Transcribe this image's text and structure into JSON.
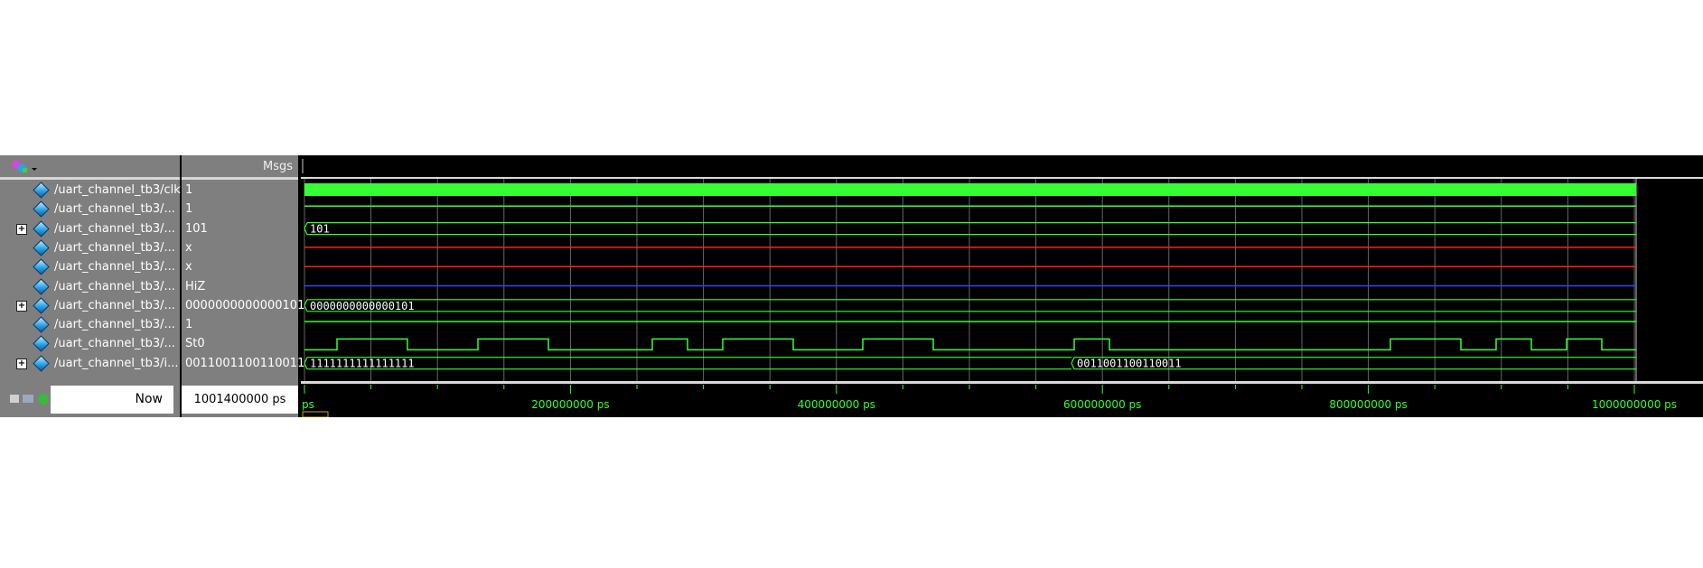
{
  "header": {
    "msgs_label": "Msgs"
  },
  "signals": [
    {
      "name": "/uart_channel_tb3/clk",
      "value": "1",
      "expandable": false
    },
    {
      "name": "/uart_channel_tb3/...",
      "value": "1",
      "expandable": false
    },
    {
      "name": "/uart_channel_tb3/...",
      "value": "101",
      "expandable": true
    },
    {
      "name": "/uart_channel_tb3/...",
      "value": "x",
      "expandable": false
    },
    {
      "name": "/uart_channel_tb3/...",
      "value": "x",
      "expandable": false
    },
    {
      "name": "/uart_channel_tb3/...",
      "value": "HiZ",
      "expandable": false
    },
    {
      "name": "/uart_channel_tb3/...",
      "value": "0000000000000101",
      "expandable": true
    },
    {
      "name": "/uart_channel_tb3/...",
      "value": "1",
      "expandable": false
    },
    {
      "name": "/uart_channel_tb3/...",
      "value": "St0",
      "expandable": false
    },
    {
      "name": "/uart_channel_tb3/i...",
      "value": "0011001100110011",
      "expandable": true
    }
  ],
  "waves": {
    "bus1_label": "101",
    "bus2_label": "0000000000000101",
    "bus3_label_a": "1111111111111111",
    "bus3_label_b": "0011001100110011"
  },
  "footer": {
    "now_label": "Now",
    "now_value": "1001400000 ps"
  },
  "timeline": {
    "start_label": "ps",
    "ticks": [
      "200000000 ps",
      "400000000 ps",
      "600000000 ps",
      "800000000 ps",
      "1000000000 ps"
    ]
  },
  "colors": {
    "wave": "#33ff33",
    "x": "#ff2020",
    "hiz": "#3344ff",
    "grid": "#ffffff",
    "bg": "#000000",
    "pane": "#7f7f7f"
  },
  "icons": {
    "signal": "signal-diamond-icon",
    "expand": "plus-box-icon",
    "toolbar": "wave-toolbar-icon"
  }
}
